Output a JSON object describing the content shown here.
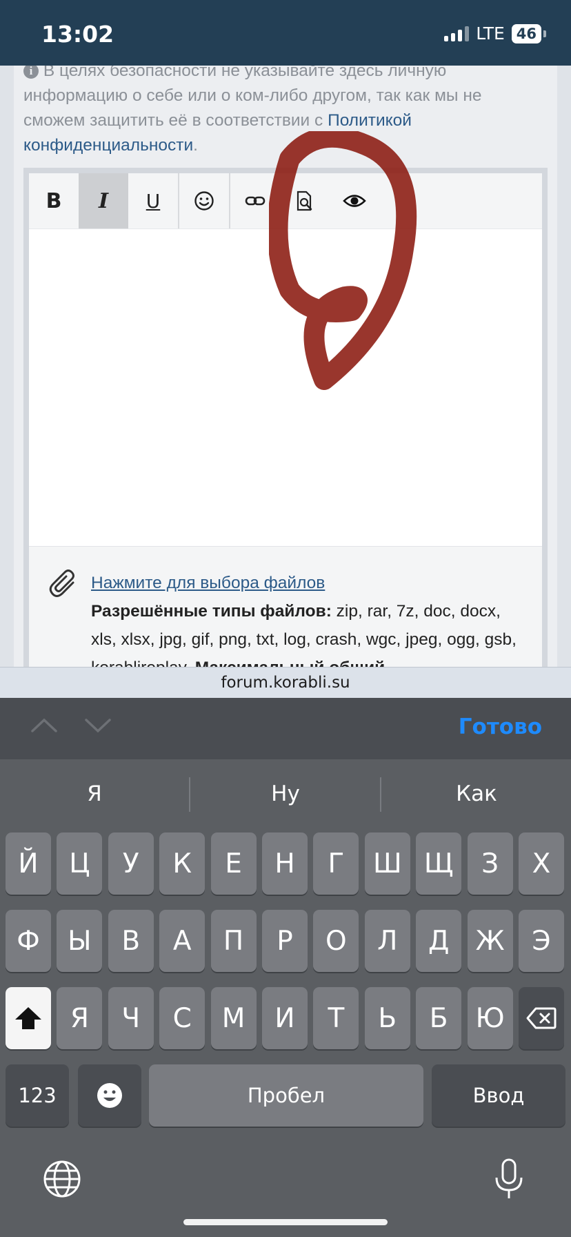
{
  "status": {
    "time": "13:02",
    "network": "LTE",
    "battery": "46"
  },
  "notice": {
    "text": "В целях безопасности не указывайте здесь личную информацию о себе или о ком-либо другом, так как мы не сможем защитить её в соответствии с ",
    "link": "Политикой конфиденциальности",
    "end": "."
  },
  "toolbar": {
    "bold": "B",
    "italic": "I",
    "underline": "U"
  },
  "attach": {
    "link": "Нажмите для выбора файлов",
    "types_label": "Разрешённые типы файлов:",
    "types": " zip, rar, 7z, doc, docx, xls, xlsx, jpg, gif, png, txt, log, crash, wgc, jpeg, ogg, gsb, korablireplay. ",
    "max_label": "Максимальный общий"
  },
  "url": "forum.korabli.su",
  "accessory": {
    "done": "Готово"
  },
  "suggestions": [
    "Я",
    "Ну",
    "Как"
  ],
  "keys": {
    "row1": [
      "Й",
      "Ц",
      "У",
      "К",
      "Е",
      "Н",
      "Г",
      "Ш",
      "Щ",
      "З",
      "Х"
    ],
    "row2": [
      "Ф",
      "Ы",
      "В",
      "А",
      "П",
      "Р",
      "О",
      "Л",
      "Д",
      "Ж",
      "Э"
    ],
    "row3": [
      "Я",
      "Ч",
      "С",
      "М",
      "И",
      "Т",
      "Ь",
      "Б",
      "Ю"
    ],
    "numbers": "123",
    "space": "Пробел",
    "return": "Ввод"
  },
  "colors": {
    "accent": "#1e8bff",
    "link": "#2c5a88",
    "status_bg": "#233f55",
    "scribble": "#8b1a10"
  }
}
